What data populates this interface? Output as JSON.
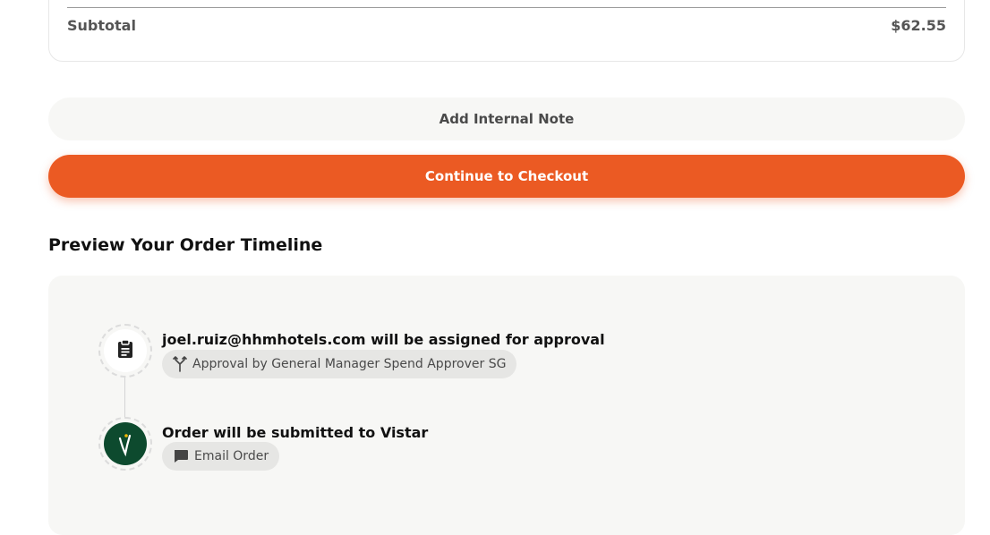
{
  "summary": {
    "subtotal_label": "Subtotal",
    "subtotal_value": "$62.55"
  },
  "actions": {
    "add_note_label": "Add Internal Note",
    "checkout_label": "Continue to Checkout"
  },
  "timeline": {
    "title": "Preview Your Order Timeline",
    "steps": [
      {
        "icon": "clipboard-icon",
        "text": "joel.ruiz@hhmhotels.com will be assigned for approval",
        "pill_icon": "fork-icon",
        "pill_label": "Approval by General Manager Spend Approver SG"
      },
      {
        "icon": "vistar-logo",
        "text": "Order will be submitted to Vistar",
        "pill_icon": "chat-bubble-icon",
        "pill_label": "Email Order"
      }
    ]
  },
  "colors": {
    "accent": "#eb5a23",
    "vendor_logo_bg": "#0d4a2e",
    "panel_bg": "#f7f7f5",
    "pill_bg": "#e6e6e4"
  }
}
